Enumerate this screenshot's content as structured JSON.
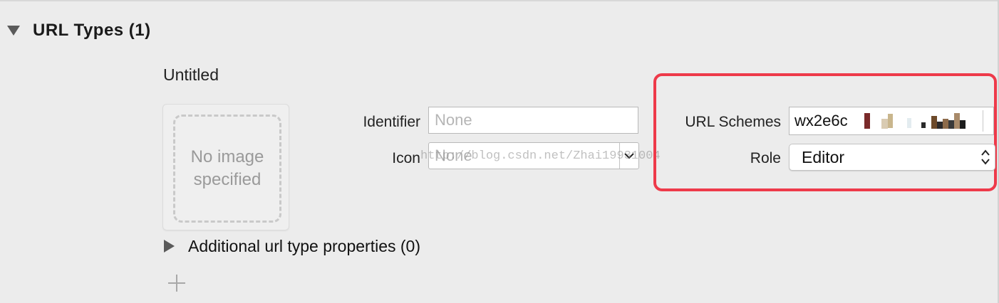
{
  "section": {
    "title": "URL Types (1)",
    "expanded": true
  },
  "url_type": {
    "name": "Untitled",
    "image_well": {
      "placeholder": "No image specified"
    },
    "identifier": {
      "label": "Identifier",
      "value": "",
      "placeholder": "None"
    },
    "icon": {
      "label": "Icon",
      "value": "None"
    },
    "url_schemes": {
      "label": "URL Schemes",
      "value": "wx2e6c"
    },
    "role": {
      "label": "Role",
      "value": "Editor"
    },
    "additional": {
      "label": "Additional url type properties (0)",
      "expanded": false
    }
  },
  "watermark": "http://blog.csdn.net/Zhai19931004",
  "colors": {
    "highlight": "#ee3a4a",
    "background": "#ececec"
  },
  "icons": {
    "section_toggle": "triangle-down-icon",
    "additional_toggle": "triangle-right-icon",
    "combo_arrow": "chevron-down-icon",
    "popup_arrows": "up-down-chevron-icon",
    "add": "plus-icon"
  }
}
